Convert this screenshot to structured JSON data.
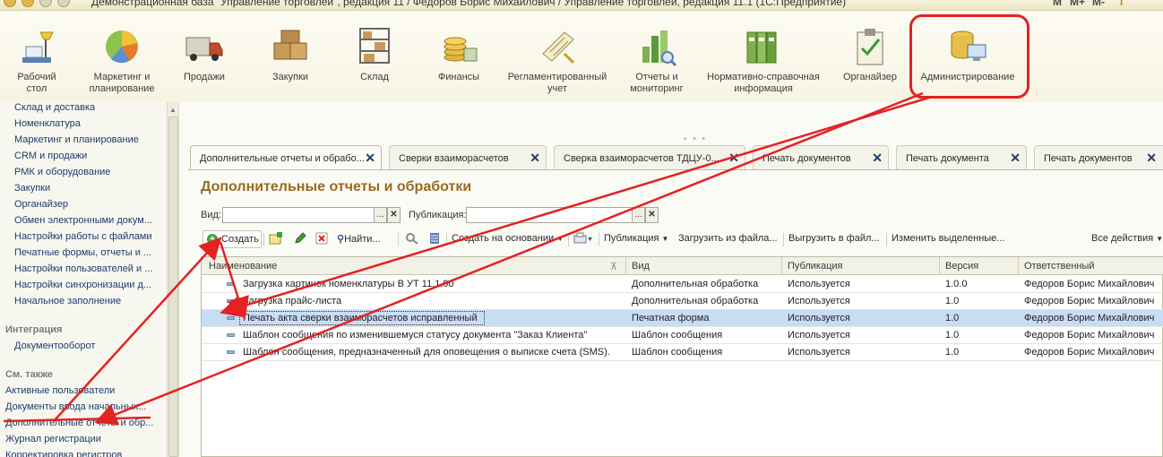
{
  "window": {
    "title": "Демонстрационная база \"Управление торговлей\", редакция 11 / Федоров Борис Михайлович / Управление торговлей, редакция 11.1 (1С:Предприятие)",
    "mem_buttons": [
      "M",
      "M+",
      "M-"
    ]
  },
  "sections": [
    {
      "label": "Рабочий стол",
      "icon": "desk-lamp-icon"
    },
    {
      "label": "Маркетинг и планирование",
      "icon": "pie-chart-icon"
    },
    {
      "label": "Продажи",
      "icon": "truck-icon"
    },
    {
      "label": "Закупки",
      "icon": "boxes-icon"
    },
    {
      "label": "Склад",
      "icon": "warehouse-shelf-icon"
    },
    {
      "label": "Финансы",
      "icon": "coins-icon"
    },
    {
      "label": "Регламентированный учет",
      "icon": "ledger-icon"
    },
    {
      "label": "Отчеты и мониторинг",
      "icon": "bar-chart-icon"
    },
    {
      "label": "Нормативно-справочная информация",
      "icon": "binders-icon"
    },
    {
      "label": "Органайзер",
      "icon": "clipboard-icon"
    },
    {
      "label": "Администрирование",
      "icon": "database-computer-icon"
    }
  ],
  "sidebar": {
    "items": [
      "Склад и доставка",
      "Номенклатура",
      "Маркетинг и планирование",
      "CRM и продажи",
      "РМК и оборудование",
      "Закупки",
      "Органайзер",
      "Обмен электронными докум...",
      "Настройки работы с файлами",
      "Печатные формы, отчеты и ...",
      "Настройки пользователей и ...",
      "Настройки синхронизации д...",
      "Начальное заполнение"
    ],
    "integration_header": "Интеграция",
    "integration_items": [
      "Документооборот"
    ],
    "see_also_header": "См. также",
    "see_also_items": [
      "Активные пользователи",
      "Документы ввода начальных...",
      "Дополнительные отчеты и обр...",
      "Журнал регистрации",
      "Корректировка регистров"
    ]
  },
  "tabs": [
    {
      "label": "Дополнительные отчеты и обрабо...",
      "active": true
    },
    {
      "label": "Сверки взаиморасчетов",
      "active": false
    },
    {
      "label": "Сверка взаиморасчетов ТДЦУ-0...",
      "active": false
    },
    {
      "label": "Печать документов",
      "active": false
    },
    {
      "label": "Печать документа",
      "active": false
    },
    {
      "label": "Печать документов",
      "active": false
    }
  ],
  "form": {
    "title": "Дополнительные отчеты и обработки",
    "filter_kind_label": "Вид:",
    "filter_kind_value": "",
    "filter_pub_label": "Публикация:",
    "filter_pub_value": "",
    "select_btn": "...",
    "clear_btn": "✕"
  },
  "toolbar": {
    "create": "Создать",
    "find": "Найти...",
    "create_based_on": "Создать на основании",
    "publication": "Публикация",
    "load_from_file": "Загрузить из файла...",
    "save_to_file": "Выгрузить в файл...",
    "change_selected": "Изменить выделенные...",
    "all_actions": "Все действия"
  },
  "table": {
    "columns": [
      "Наименование",
      "Вид",
      "Публикация",
      "Версия",
      "Ответственный"
    ],
    "rows": [
      {
        "name": "Загрузка картинок номенклатуры В УТ 11.1.90",
        "kind": "Дополнительная обработка",
        "pub": "Используется",
        "ver": "1.0.0",
        "owner": "Федоров Борис Михайлович",
        "selected": false
      },
      {
        "name": "Загрузка прайс-листа",
        "kind": "Дополнительная обработка",
        "pub": "Используется",
        "ver": "1.0",
        "owner": "Федоров Борис Михайлович",
        "selected": false
      },
      {
        "name": "Печать акта сверки взаиморасчетов исправленный",
        "kind": "Печатная форма",
        "pub": "Используется",
        "ver": "1.0",
        "owner": "Федоров Борис Михайлович",
        "selected": true
      },
      {
        "name": "Шаблон сообщения по изменившемуся статусу документа \"Заказ Клиента\"",
        "kind": "Шаблон сообщения",
        "pub": "Используется",
        "ver": "1.0",
        "owner": "Федоров Борис Михайлович",
        "selected": false
      },
      {
        "name": "Шаблон сообщения, предназначенный для оповещения о выписке счета (SMS).",
        "kind": "Шаблон сообщения",
        "pub": "Используется",
        "ver": "1.0",
        "owner": "Федоров Борис Михайлович",
        "selected": false
      }
    ]
  },
  "colors": {
    "annotation_red": "#e32222",
    "title_brown": "#9a6a1e",
    "selection_blue": "#c8ddf3",
    "link_blue": "#1c3c6c"
  }
}
